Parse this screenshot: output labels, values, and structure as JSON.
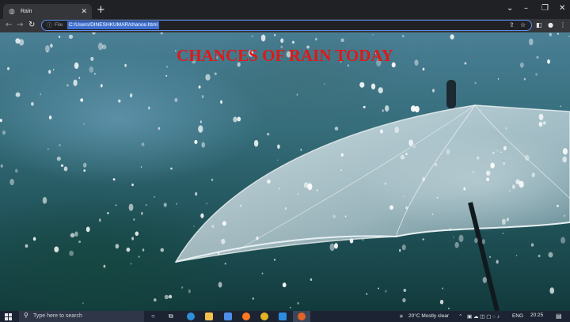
{
  "browser": {
    "tab_title": "Rain",
    "tab_icon": "globe-icon",
    "url_scheme": "File",
    "url": "C:/Users/DINESHKUMAR/chance.html"
  },
  "page": {
    "title": "CHANCES OF RAIN TODAY",
    "title_color": "#e01818",
    "background_image": "rain drops on umbrella"
  },
  "taskbar": {
    "search_placeholder": "Type here to search",
    "weather": "20°C  Mostly clear",
    "language": "ENG",
    "time": "20:25"
  }
}
